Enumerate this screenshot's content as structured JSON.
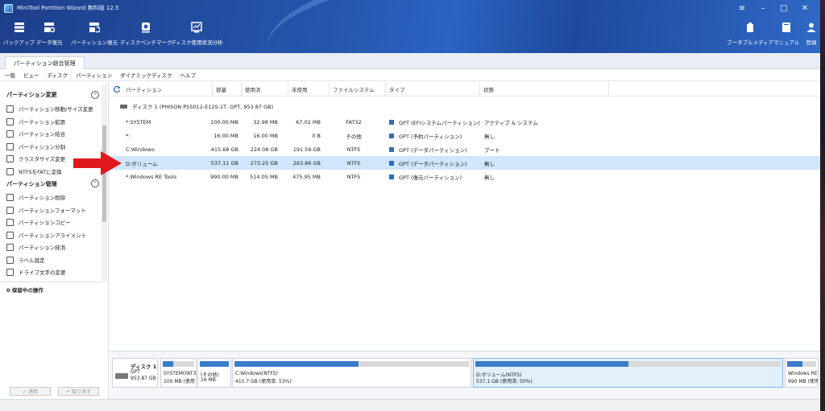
{
  "window": {
    "title": "MiniTool Partition Wizard 無料版 12.5"
  },
  "colors": {
    "accent": "#2556ad",
    "selected_row": "#cfe6fb",
    "used_bar": "#3b7cc9",
    "arrow": "#e0191f"
  },
  "toolbar": {
    "backup": "バックアップ",
    "data_recovery": "データ復元",
    "partition_recovery": "パーティション復元",
    "disk_benchmark": "ディスクベンチマーク",
    "space_analyzer": "ディスク使用状況分析",
    "bootable_media": "ブータブルメディア",
    "manual": "マニュアル",
    "register": "登録"
  },
  "tab": {
    "label": "パーティション総合管理"
  },
  "menu": [
    "一般",
    "ビュー",
    "ディスク",
    "パーティション",
    "ダイナミックディスク",
    "ヘルプ"
  ],
  "sidebar": {
    "group1_title": "パーティション変更",
    "group1_items": [
      {
        "label": "パーティション移動/サイズ変更",
        "icon": "move-resize-icon"
      },
      {
        "label": "パーティション拡張",
        "icon": "extend-icon"
      },
      {
        "label": "パーティション結合",
        "icon": "merge-icon"
      },
      {
        "label": "パーティション分割",
        "icon": "split-icon"
      },
      {
        "label": "クラスタサイズ変更",
        "icon": "cluster-icon"
      },
      {
        "label": "NTFSをFATに変換",
        "icon": "convert-icon"
      }
    ],
    "group2_title": "パーティション管理",
    "group2_items": [
      {
        "label": "パーティション削除",
        "icon": "trash-icon"
      },
      {
        "label": "パーティションフォーマット",
        "icon": "format-icon"
      },
      {
        "label": "パーティションコピー",
        "icon": "copy-icon"
      },
      {
        "label": "パーティションアライメント",
        "icon": "align-icon"
      },
      {
        "label": "パーティション抹消",
        "icon": "wipe-icon"
      },
      {
        "label": "ラベル設定",
        "icon": "label-icon"
      },
      {
        "label": "ドライブ文字の変更",
        "icon": "drive-letter-icon"
      }
    ],
    "pending": "0 保留中の操作",
    "apply": "✓ 適用",
    "undo": "↶ 取り消す"
  },
  "table": {
    "headers": [
      "パーティション",
      "容量",
      "使用済",
      "未使用",
      "ファイルシステム",
      "タイプ",
      "状態"
    ],
    "disk_label": "ディスク 1 (PHISON PS5012-E12S-1T, GPT, 953.87 GB)",
    "rows": [
      {
        "partition": "*:SYSTEM",
        "capacity": "100.00 MB",
        "used": "32.98 MB",
        "unused": "67.02 MB",
        "fs": "FAT32",
        "type": "GPT (EFIシステムパーティション)",
        "status": "アクティブ & システム"
      },
      {
        "partition": "*:",
        "capacity": "16.00 MB",
        "used": "16.00 MB",
        "unused": "0 B",
        "fs": "その他",
        "type": "GPT (予約パーティション)",
        "status": "無し"
      },
      {
        "partition": "C:Windows",
        "capacity": "415.68 GB",
        "used": "224.08 GB",
        "unused": "191.59 GB",
        "fs": "NTFS",
        "type": "GPT (データパーティション)",
        "status": "ブート"
      },
      {
        "partition": "D:ボリューム",
        "capacity": "537.11 GB",
        "used": "273.25 GB",
        "unused": "263.86 GB",
        "fs": "NTFS",
        "type": "GPT (データパーティション)",
        "status": "無し"
      },
      {
        "partition": "*:Windows RE Tools",
        "capacity": "990.00 MB",
        "used": "514.05 MB",
        "unused": "475.95 MB",
        "fs": "NTFS",
        "type": "GPT (復元パーティション)",
        "status": "無し"
      }
    ]
  },
  "diskmap": {
    "disk": {
      "name": "ディスク 1",
      "type": "GPT",
      "size": "953.87 GB"
    },
    "partitions": [
      {
        "l1": "SYSTEM(FAT3",
        "l2": "100 MB (使用",
        "used": 0.33
      },
      {
        "l1": "(その他)",
        "l2": "16 MB",
        "used": 1.0
      },
      {
        "l1": "C:Windows(NTFS)",
        "l2": "415.7 GB (使用済: 53%)",
        "used": 0.53
      },
      {
        "l1": "D:ボリューム(NTFS)",
        "l2": "537.1 GB (使用済: 50%)",
        "used": 0.5
      },
      {
        "l1": "Windows RE",
        "l2": "990 MB (使用",
        "used": 0.52
      }
    ]
  }
}
